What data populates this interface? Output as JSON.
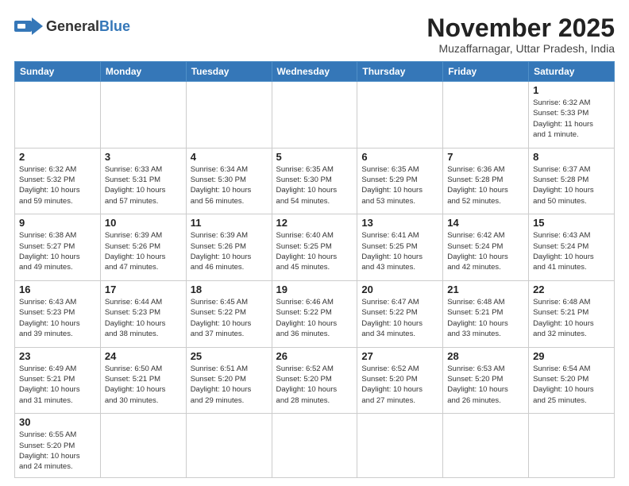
{
  "header": {
    "logo_general": "General",
    "logo_blue": "Blue",
    "month_year": "November 2025",
    "location": "Muzaffarnagar, Uttar Pradesh, India"
  },
  "days_of_week": [
    "Sunday",
    "Monday",
    "Tuesday",
    "Wednesday",
    "Thursday",
    "Friday",
    "Saturday"
  ],
  "weeks": [
    [
      null,
      null,
      null,
      null,
      null,
      null,
      {
        "day": "1",
        "info": "Sunrise: 6:32 AM\nSunset: 5:33 PM\nDaylight: 11 hours\nand 1 minute."
      }
    ],
    [
      {
        "day": "2",
        "info": "Sunrise: 6:32 AM\nSunset: 5:32 PM\nDaylight: 10 hours\nand 59 minutes."
      },
      {
        "day": "3",
        "info": "Sunrise: 6:33 AM\nSunset: 5:31 PM\nDaylight: 10 hours\nand 57 minutes."
      },
      {
        "day": "4",
        "info": "Sunrise: 6:34 AM\nSunset: 5:30 PM\nDaylight: 10 hours\nand 56 minutes."
      },
      {
        "day": "5",
        "info": "Sunrise: 6:35 AM\nSunset: 5:30 PM\nDaylight: 10 hours\nand 54 minutes."
      },
      {
        "day": "6",
        "info": "Sunrise: 6:35 AM\nSunset: 5:29 PM\nDaylight: 10 hours\nand 53 minutes."
      },
      {
        "day": "7",
        "info": "Sunrise: 6:36 AM\nSunset: 5:28 PM\nDaylight: 10 hours\nand 52 minutes."
      },
      {
        "day": "8",
        "info": "Sunrise: 6:37 AM\nSunset: 5:28 PM\nDaylight: 10 hours\nand 50 minutes."
      }
    ],
    [
      {
        "day": "9",
        "info": "Sunrise: 6:38 AM\nSunset: 5:27 PM\nDaylight: 10 hours\nand 49 minutes."
      },
      {
        "day": "10",
        "info": "Sunrise: 6:39 AM\nSunset: 5:26 PM\nDaylight: 10 hours\nand 47 minutes."
      },
      {
        "day": "11",
        "info": "Sunrise: 6:39 AM\nSunset: 5:26 PM\nDaylight: 10 hours\nand 46 minutes."
      },
      {
        "day": "12",
        "info": "Sunrise: 6:40 AM\nSunset: 5:25 PM\nDaylight: 10 hours\nand 45 minutes."
      },
      {
        "day": "13",
        "info": "Sunrise: 6:41 AM\nSunset: 5:25 PM\nDaylight: 10 hours\nand 43 minutes."
      },
      {
        "day": "14",
        "info": "Sunrise: 6:42 AM\nSunset: 5:24 PM\nDaylight: 10 hours\nand 42 minutes."
      },
      {
        "day": "15",
        "info": "Sunrise: 6:43 AM\nSunset: 5:24 PM\nDaylight: 10 hours\nand 41 minutes."
      }
    ],
    [
      {
        "day": "16",
        "info": "Sunrise: 6:43 AM\nSunset: 5:23 PM\nDaylight: 10 hours\nand 39 minutes."
      },
      {
        "day": "17",
        "info": "Sunrise: 6:44 AM\nSunset: 5:23 PM\nDaylight: 10 hours\nand 38 minutes."
      },
      {
        "day": "18",
        "info": "Sunrise: 6:45 AM\nSunset: 5:22 PM\nDaylight: 10 hours\nand 37 minutes."
      },
      {
        "day": "19",
        "info": "Sunrise: 6:46 AM\nSunset: 5:22 PM\nDaylight: 10 hours\nand 36 minutes."
      },
      {
        "day": "20",
        "info": "Sunrise: 6:47 AM\nSunset: 5:22 PM\nDaylight: 10 hours\nand 34 minutes."
      },
      {
        "day": "21",
        "info": "Sunrise: 6:48 AM\nSunset: 5:21 PM\nDaylight: 10 hours\nand 33 minutes."
      },
      {
        "day": "22",
        "info": "Sunrise: 6:48 AM\nSunset: 5:21 PM\nDaylight: 10 hours\nand 32 minutes."
      }
    ],
    [
      {
        "day": "23",
        "info": "Sunrise: 6:49 AM\nSunset: 5:21 PM\nDaylight: 10 hours\nand 31 minutes."
      },
      {
        "day": "24",
        "info": "Sunrise: 6:50 AM\nSunset: 5:21 PM\nDaylight: 10 hours\nand 30 minutes."
      },
      {
        "day": "25",
        "info": "Sunrise: 6:51 AM\nSunset: 5:20 PM\nDaylight: 10 hours\nand 29 minutes."
      },
      {
        "day": "26",
        "info": "Sunrise: 6:52 AM\nSunset: 5:20 PM\nDaylight: 10 hours\nand 28 minutes."
      },
      {
        "day": "27",
        "info": "Sunrise: 6:52 AM\nSunset: 5:20 PM\nDaylight: 10 hours\nand 27 minutes."
      },
      {
        "day": "28",
        "info": "Sunrise: 6:53 AM\nSunset: 5:20 PM\nDaylight: 10 hours\nand 26 minutes."
      },
      {
        "day": "29",
        "info": "Sunrise: 6:54 AM\nSunset: 5:20 PM\nDaylight: 10 hours\nand 25 minutes."
      }
    ],
    [
      {
        "day": "30",
        "info": "Sunrise: 6:55 AM\nSunset: 5:20 PM\nDaylight: 10 hours\nand 24 minutes."
      },
      null,
      null,
      null,
      null,
      null,
      null
    ]
  ]
}
